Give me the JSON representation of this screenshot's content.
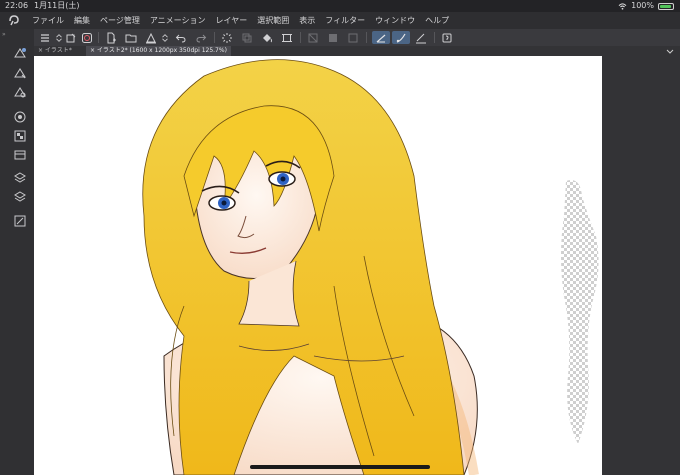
{
  "status": {
    "time": "22:06",
    "date": "1月11日(土)",
    "battery": "100%"
  },
  "menu": {
    "items": [
      "ファイル",
      "編集",
      "ページ管理",
      "アニメーション",
      "レイヤー",
      "選択範囲",
      "表示",
      "フィルター",
      "ウィンドウ",
      "ヘルプ"
    ]
  },
  "toolbar": {
    "icons": [
      "menu-icon",
      "stepper-icon",
      "new-file-icon",
      "color-wheel-icon",
      "new-page-icon",
      "open-folder-icon",
      "save-icon",
      "updown-icon",
      "undo-icon",
      "redo-icon",
      "loading-icon",
      "transform-icon",
      "fill-icon",
      "crop-icon",
      "clear-icon",
      "gradient-icon",
      "frame-icon",
      "pen-stabilize-icon",
      "brush-stabilize-icon",
      "ruler-pen-icon",
      "quick-access-icon"
    ]
  },
  "tabs": [
    {
      "label": "× イラスト*"
    },
    {
      "label": "× イラスト2* (1600 x 1200px 350dpi 125.7%)"
    }
  ],
  "colors": {
    "accent": "#4b6585",
    "hair": "#f2c21f",
    "background": "#2b2b2e"
  }
}
